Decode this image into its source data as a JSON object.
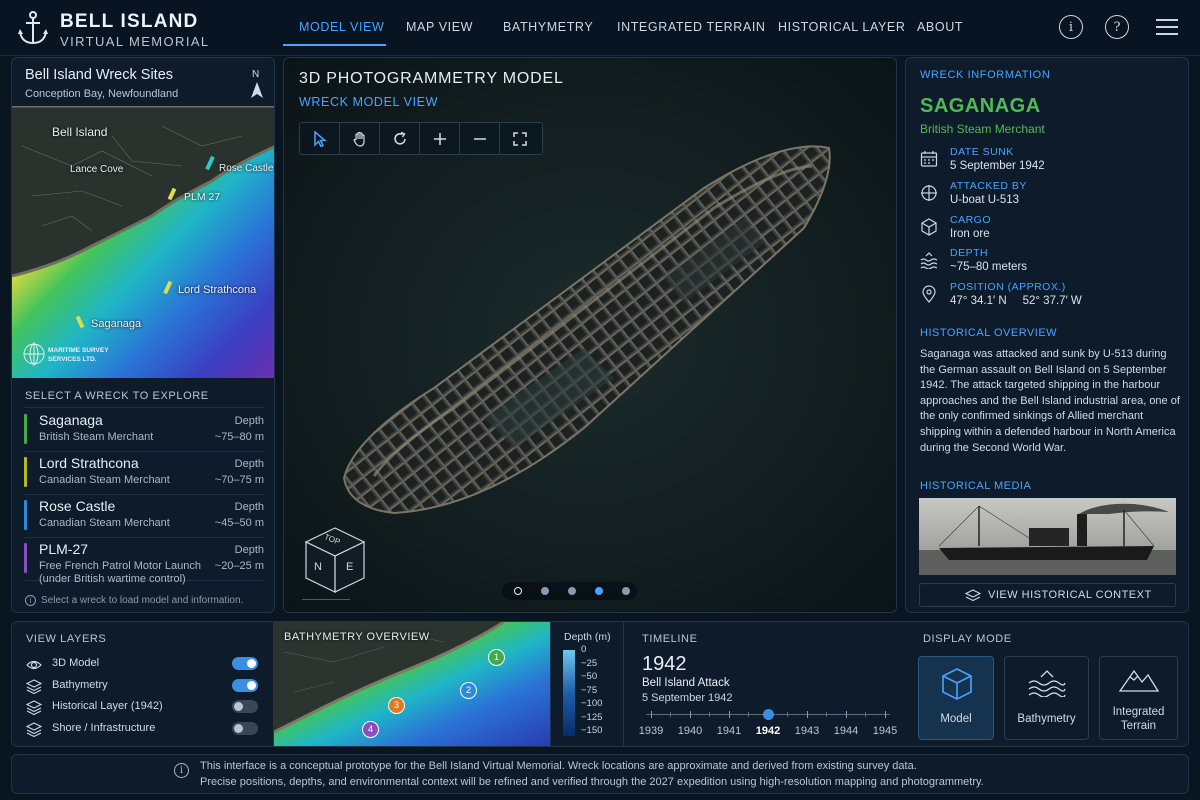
{
  "header": {
    "title": "BELL ISLAND",
    "subtitle": "VIRTUAL MEMORIAL",
    "nav": [
      "MODEL VIEW",
      "MAP VIEW",
      "BATHYMETRY",
      "INTEGRATED TERRAIN",
      "HISTORICAL LAYER",
      "ABOUT"
    ],
    "active_nav": "MODEL VIEW",
    "icons": [
      "info-icon",
      "help-icon",
      "menu-icon"
    ]
  },
  "left_panel": {
    "title": "Bell Island Wreck Sites",
    "subtitle": "Conception Bay, Newfoundland",
    "compass": "N",
    "map_labels": {
      "island": "Bell Island",
      "cove": "Lance Cove",
      "rose": "Rose Castle",
      "plm": "PLM 27",
      "lord": "Lord Strathcona",
      "sag": "Saganaga"
    },
    "survey_logo": {
      "line1": "MARITIME SURVEY",
      "line2": "SERVICES LTD."
    },
    "select_heading": "SELECT A WRECK TO EXPLORE",
    "wrecks": [
      {
        "name": "Saganaga",
        "type": "British Steam Merchant",
        "type2": "",
        "depth_label": "Depth",
        "depth": "~75–80 m",
        "color": "#3fae49"
      },
      {
        "name": "Lord Strathcona",
        "type": "Canadian Steam Merchant",
        "type2": "",
        "depth_label": "Depth",
        "depth": "~70–75 m",
        "color": "#b7b821"
      },
      {
        "name": "Rose Castle",
        "type": "Canadian Steam Merchant",
        "type2": "",
        "depth_label": "Depth",
        "depth": "~45–50 m",
        "color": "#2a8bdb"
      },
      {
        "name": "PLM-27",
        "type": "Free French Patrol Motor Launch",
        "type2": "(under British wartime control)",
        "depth_label": "Depth",
        "depth": "~20–25 m",
        "color": "#8a4fbf"
      }
    ],
    "hint": "Select a wreck to load model and information."
  },
  "center": {
    "title": "3D PHOTOGRAMMETRY MODEL",
    "subtitle": "WRECK MODEL VIEW",
    "tools": [
      "select-icon",
      "pan-icon",
      "rotate-icon",
      "zoom-in-icon",
      "zoom-out-icon",
      "fullscreen-icon"
    ],
    "cube": {
      "top": "TOP",
      "n": "N",
      "e": "E"
    },
    "carousel_total": 5,
    "carousel_active": 4
  },
  "right_panel": {
    "section": "WRECK INFORMATION",
    "ship_name": "SAGANAGA",
    "ship_type": "British Steam Merchant",
    "facts": [
      {
        "icon": "calendar-icon",
        "key": "DATE SUNK",
        "value": "5 September 1942"
      },
      {
        "icon": "crosshair-icon",
        "key": "ATTACKED BY",
        "value": "U-boat U-513"
      },
      {
        "icon": "cube-icon",
        "key": "CARGO",
        "value": "Iron ore"
      },
      {
        "icon": "waves-icon",
        "key": "DEPTH",
        "value": "~75–80 meters"
      },
      {
        "icon": "pin-icon",
        "key": "POSITION (APPROX.)",
        "value": "47° 34.1′ N     52° 37.7′ W"
      }
    ],
    "overview_heading": "HISTORICAL OVERVIEW",
    "overview": "Saganaga was attacked and sunk by U-513 during the German assault on Bell Island on 5 September 1942. The attack targeted shipping in the harbour approaches and the Bell Island industrial area, one of the only confirmed sinkings of Allied merchant shipping within a defended harbour in North America during the Second World War.",
    "media_heading": "HISTORICAL MEDIA",
    "context_button": "VIEW HISTORICAL CONTEXT"
  },
  "layers": {
    "heading": "VIEW LAYERS",
    "items": [
      {
        "icon": "eye-icon",
        "label": "3D Model",
        "on": true
      },
      {
        "icon": "layers-icon",
        "label": "Bathymetry",
        "on": true
      },
      {
        "icon": "layers-icon",
        "label": "Historical Layer (1942)",
        "on": false
      },
      {
        "icon": "layers-icon",
        "label": "Shore / Infrastructure",
        "on": false
      }
    ]
  },
  "bathy": {
    "heading": "BATHYMETRY OVERVIEW",
    "markers": [
      "1",
      "2",
      "3",
      "4"
    ],
    "legend_title": "Depth (m)",
    "legend_ticks": [
      "0",
      "−25",
      "−50",
      "−75",
      "−100",
      "−125",
      "−150"
    ]
  },
  "timeline": {
    "heading": "TIMELINE",
    "year": "1942",
    "event": "Bell Island Attack",
    "date": "5 September 1942",
    "years": [
      "1939",
      "1940",
      "1941",
      "1942",
      "1943",
      "1944",
      "1945"
    ],
    "selected": "1942"
  },
  "display_mode": {
    "heading": "DISPLAY MODE",
    "modes": [
      {
        "label": "Model",
        "active": true
      },
      {
        "label": "Bathymetry",
        "active": false
      },
      {
        "label": "Integrated Terrain",
        "active": false
      }
    ]
  },
  "footer": {
    "line1": "This interface is a conceptual prototype for the Bell Island Virtual Memorial. Wreck locations are approximate and derived from existing survey data.",
    "line2": "Precise positions, depths, and environmental context will be refined and verified through the 2027 expedition using high-resolution mapping and photogrammetry."
  }
}
